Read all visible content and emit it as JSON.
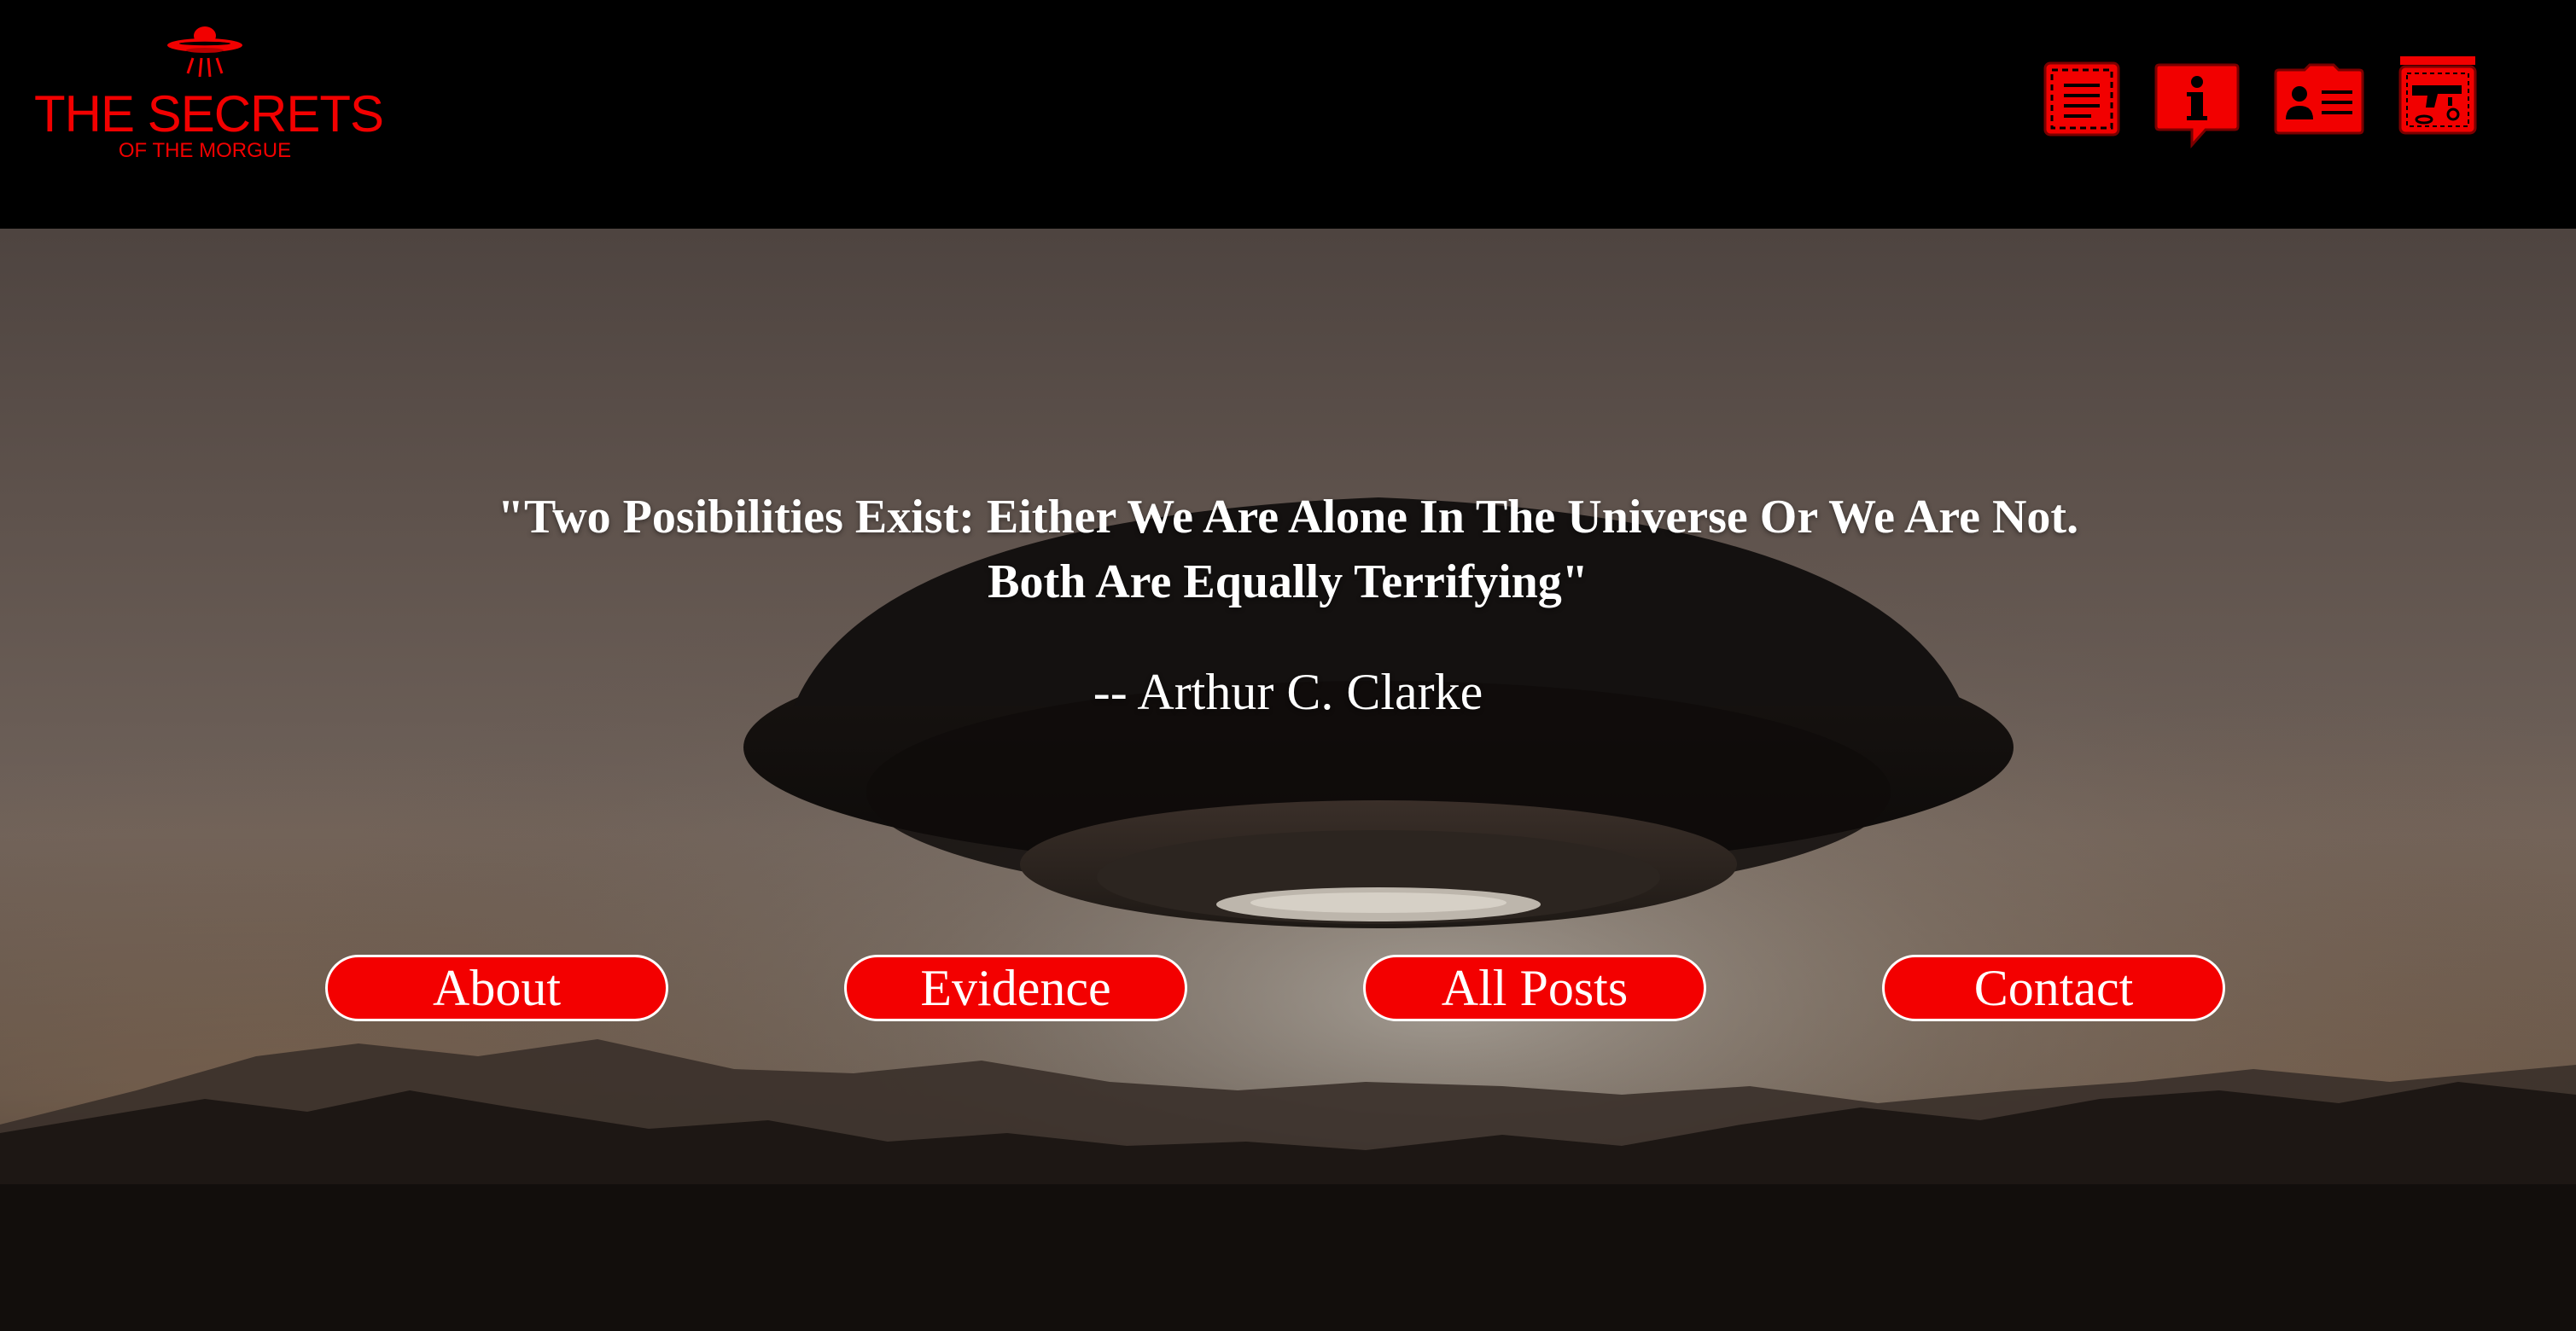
{
  "brand": {
    "title": "THE SECRETS",
    "subtitle": "OF THE MORGUE",
    "logo_icon": "ufo-icon",
    "color": "#f20000"
  },
  "nav_icons": [
    {
      "name": "document-icon"
    },
    {
      "name": "info-bubble-icon"
    },
    {
      "name": "contact-card-icon"
    },
    {
      "name": "evidence-gun-icon"
    }
  ],
  "hero": {
    "quote": "\"Two Posibilities Exist: Either We Are Alone In The Universe Or We Are Not. Both Are Equally Terrifying\"",
    "author": "-- Arthur C. Clarke",
    "background": "ufo-over-mountains-image"
  },
  "buttons": {
    "about": "About",
    "evidence": "Evidence",
    "posts": "All Posts",
    "contact": "Contact"
  },
  "colors": {
    "accent": "#f30000",
    "header_bg": "#000000",
    "text": "#ffffff"
  }
}
